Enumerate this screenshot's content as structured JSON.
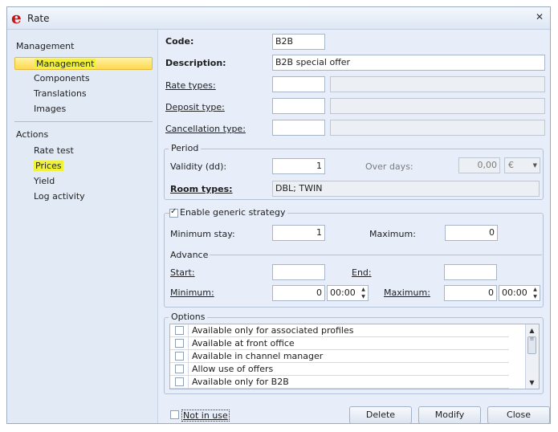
{
  "window": {
    "title": "Rate",
    "app_icon": "e",
    "close_icon": "close-icon"
  },
  "sidebar": {
    "management_header": "Management",
    "management_items": [
      {
        "label": "Management",
        "selected": true
      },
      {
        "label": "Components"
      },
      {
        "label": "Translations"
      },
      {
        "label": "Images"
      }
    ],
    "actions_header": "Actions",
    "actions_items": [
      {
        "label": "Rate test"
      },
      {
        "label": "Prices",
        "highlighted": true
      },
      {
        "label": "Yield"
      },
      {
        "label": "Log activity"
      }
    ]
  },
  "form": {
    "code_label": "Code:",
    "code_value": "B2B",
    "description_label": "Description:",
    "description_value": "B2B special offer",
    "rate_types_label": "Rate types:",
    "rate_types_code": "",
    "rate_types_name": "",
    "deposit_type_label": "Deposit type:",
    "deposit_type_code": "",
    "deposit_type_name": "",
    "cancellation_type_label": "Cancellation type:",
    "cancellation_type_code": "",
    "cancellation_type_name": ""
  },
  "period": {
    "group_title": "Period",
    "validity_label": "Validity (dd):",
    "validity_value": "1",
    "over_days_label": "Over days:",
    "over_days_value": "0,00",
    "currency_value": "€",
    "room_types_label": "Room types:",
    "room_types_value": "DBL; TWIN"
  },
  "generic": {
    "enable_label": "Enable generic strategy",
    "enable_checked": true,
    "minimum_stay_label": "Minimum stay:",
    "minimum_stay_value": "1",
    "maximum_label": "Maximum:",
    "maximum_value": "0",
    "advance_title": "Advance",
    "start_label": "Start:",
    "start_value": "",
    "end_label": "End:",
    "end_value": "",
    "minimum_label": "Minimum:",
    "minimum_value": "0",
    "minimum_time": "00:00",
    "adv_maximum_label": "Maximum:",
    "adv_maximum_value": "0",
    "adv_maximum_time": "00:00"
  },
  "options": {
    "group_title": "Options",
    "items": [
      {
        "label": "Available only for associated profiles",
        "checked": false
      },
      {
        "label": "Available at front office",
        "checked": false
      },
      {
        "label": "Available in channel manager",
        "checked": false
      },
      {
        "label": "Allow use of offers",
        "checked": false
      },
      {
        "label": "Available only for B2B",
        "checked": false
      }
    ]
  },
  "footer": {
    "not_in_use_label": "Not in use",
    "not_in_use_checked": false,
    "delete_label": "Delete",
    "modify_label": "Modify",
    "close_label": "Close"
  },
  "colors": {
    "selected_item": "#ffd84d",
    "highlight": "#f0f23a",
    "app_icon": "#c71818",
    "panel_bg": "#e7eefa"
  }
}
